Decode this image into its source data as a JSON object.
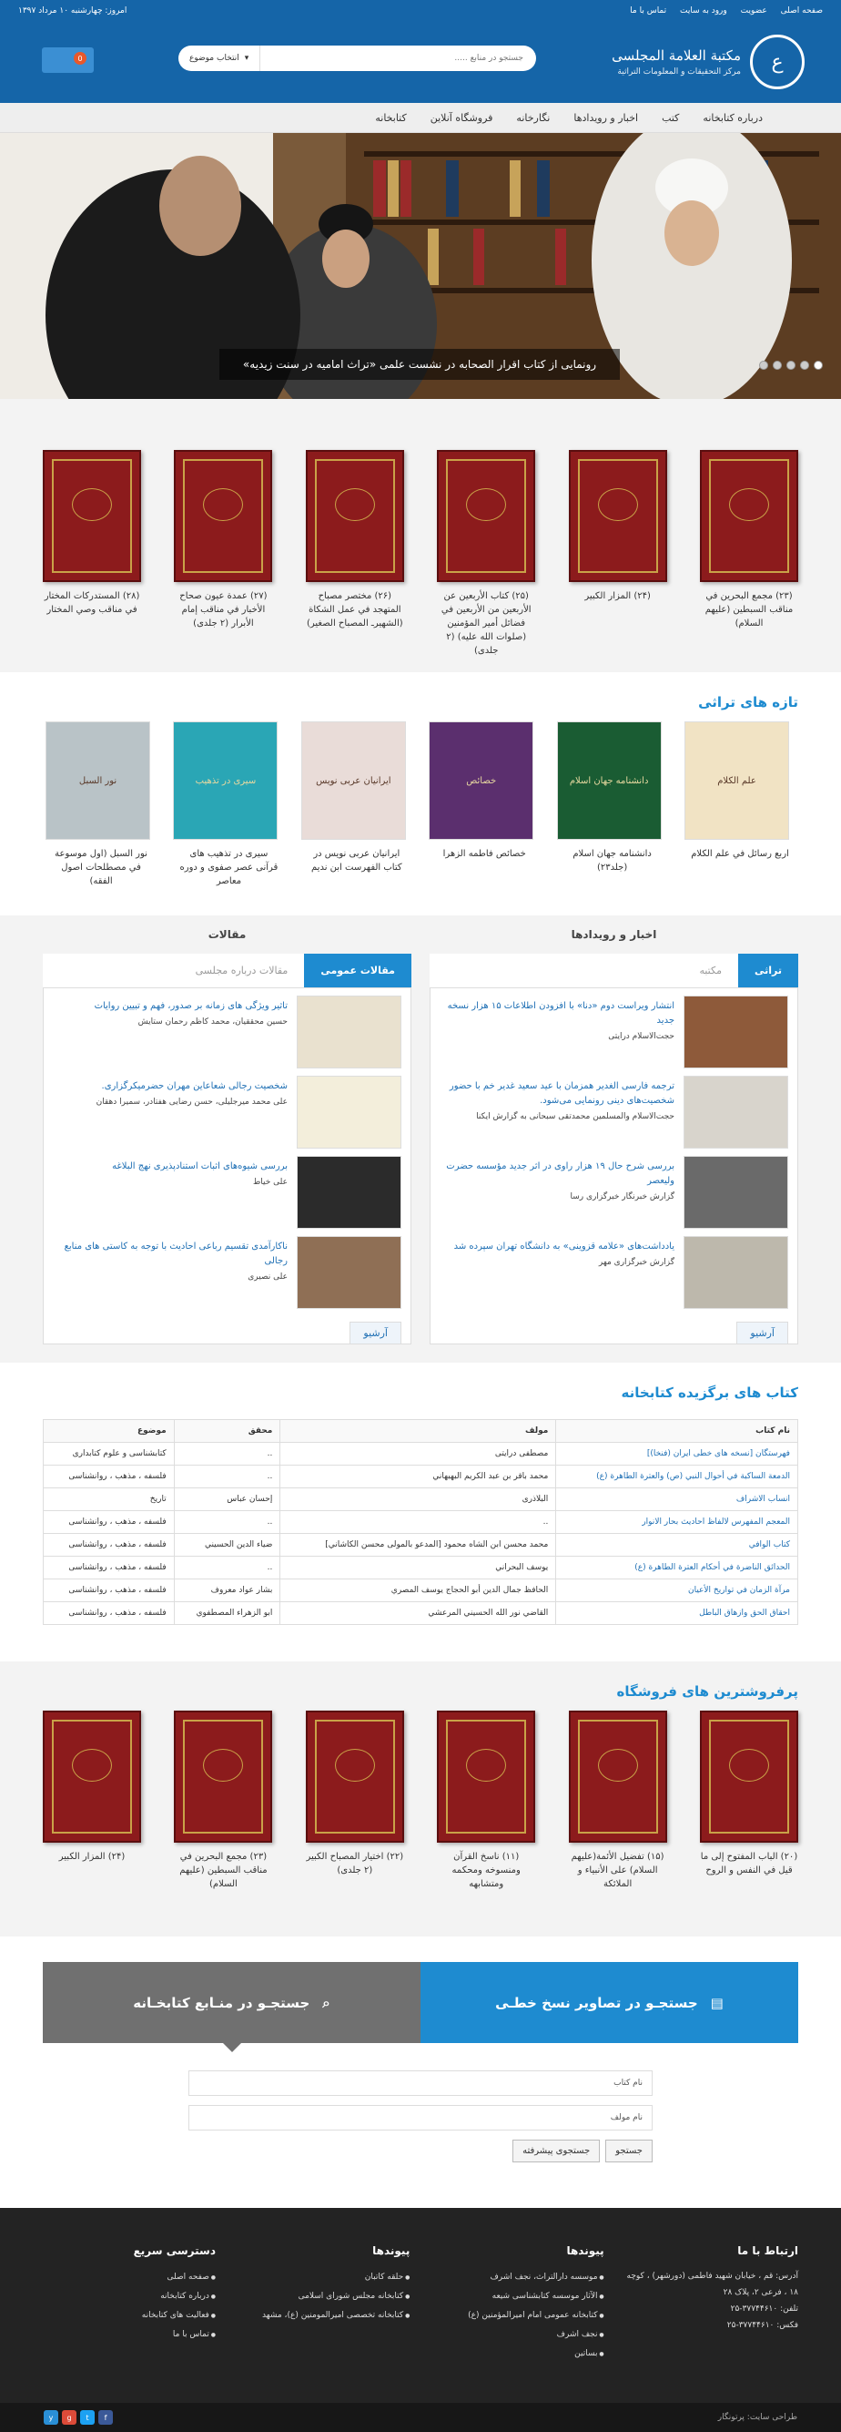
{
  "topbar": {
    "links": [
      "صفحه اصلی",
      "عضویت",
      "ورود به سایت",
      "تماس با ما"
    ],
    "date": "امروز: چهارشنبه ۱۰ مرداد ۱۳۹۷"
  },
  "logo": {
    "seal": "ع",
    "line1": "مکتبة العلامة المجلسی",
    "line2": "مرکز التحقیقات و المعلومات التراثیة"
  },
  "search": {
    "placeholder": "جستجو در منابع .....",
    "select_label": "انتخاب موضوع"
  },
  "cart": {
    "count": "0"
  },
  "nav": [
    "درباره کتابخانه",
    "کتب",
    "اخبار و رویدادها",
    "نگارخانه",
    "فروشگاه آنلاین",
    "کتابخانه"
  ],
  "hero": {
    "caption": "رونمایی از کتاب اقرار الصحابه در نشست علمی «تراث امامیه در سنت زیدیه»",
    "dots": 5
  },
  "popular": {
    "books": [
      "(۲۳) مجمع البحرين في مناقب السبطين (عليهم السلام)",
      "(۲۴) المزار الكبير",
      "(۲۵) كتاب الأربعين عن الأربعين من الأربعين في فضائل أمير المؤمنين (صلوات الله عليه) (۲ جلدی)",
      "(۲۶) مختصر مصباح المتهجد في عمل الشكاة (الشهيرـ المصباح الصغير)",
      "(۲۷) عمدة عيون صحاح الأخبار في مناقب إمام الأبرار (۲ جلدی)",
      "(۲۸) المستدركات المختار في مناقب وصي المختار"
    ]
  },
  "new": {
    "title": "تازه های تراثی",
    "books": [
      {
        "name": "اربع رسائل في علم الكلام",
        "cover": "#f1e3c4",
        "cover_text": "علم الكلام"
      },
      {
        "name": "دانشنامه جهان اسلام (جلد۲۳)",
        "cover": "#1a5c33",
        "cover_text": "دانشنامه جهان اسلام"
      },
      {
        "name": "خصائص فاطمه الزهرا",
        "cover": "#5b2f6e",
        "cover_text": "خصائص"
      },
      {
        "name": "ایرانیان عربی نویس در کتاب الفهرست ابن ندیم",
        "cover": "#e9dcd8",
        "cover_text": "ایرانیان عربی نویس"
      },
      {
        "name": "سیری در تذهیب های قرآنی عصر صفوی و دوره معاصر",
        "cover": "#2aa6b5",
        "cover_text": "سیری در تذهیب"
      },
      {
        "name": "نور السبل (اول موسوعة في مصطلحات اصول الفقه)",
        "cover": "#b9c3c7",
        "cover_text": "نور السبل"
      }
    ]
  },
  "news": {
    "heading": "اخبار و رویدادها",
    "tabs": [
      "تراثی",
      "مکتبه"
    ],
    "items": [
      {
        "title": "انتشار ویراست دوم «دنا» با افزودن اطلاعات ۱۵ هزار نسخه جدید",
        "sub": "حجت‌الاسلام درایتی"
      },
      {
        "title": "ترجمه فارسی الغدیر همزمان با عید سعید غدیر خم با حضور شخصیت‌های دینی رونمایی می‌شود.",
        "sub": "حجت‌الاسلام والمسلمین محمدتقی سبحانی به گزارش ایکنا"
      },
      {
        "title": "بررسی شرح حال ۱۹ هزار راوی در اثر جدید مؤسسه حضرت ولیعصر",
        "sub": "گزارش خبرنگار خبرگزاری رسا"
      },
      {
        "title": "یادداشت‌های «علامه قزوینی» به دانشگاه تهران سپرده شد",
        "sub": "گزارش خبرگزاری مهر"
      }
    ],
    "archive": "آرشیو"
  },
  "articles": {
    "heading": "مقالات",
    "tabs": [
      "مقالات عمومی",
      "مقالات درباره مجلسی"
    ],
    "items": [
      {
        "title": "تاثیر ویژگی های زمانه بر صدور، فهم و تبیین روایات",
        "sub": "حسین محققیان، محمد کاظم رحمان ستایش"
      },
      {
        "title": "شخصیت رجالی شعاعاین مهران حضرمیکرگزاری.",
        "sub": "علی محمد میرجلیلی، حسن رضایی هفتادر، سمیرا دهقان"
      },
      {
        "title": "بررسی شیوه‌های اثبات استنادپذیری نهج البلاغه",
        "sub": "علی خیاط"
      },
      {
        "title": "ناکارآمدی تقسیم رباعی احادیث با توجه به کاستی های منابع رجالی",
        "sub": "علی نصیری"
      }
    ],
    "archive": "آرشیو"
  },
  "featured": {
    "title": "کتاب های برگزیده کتابخانه",
    "headers": [
      "نام کتاب",
      "مولف",
      "محقق",
      "موضوع"
    ],
    "rows": [
      [
        "فهرستگان [نسخه های خطی ایران (فنخا)]",
        "مصطفی درایتی",
        "..",
        "کتابشناسی و علوم کتابداری"
      ],
      [
        "الدمعة الساكبة في أحوال النبي (ص) والعترة الطاهرة (ع)",
        "محمد باقر بن عبد الكريم البهبهاني",
        "..",
        "فلسفه ، مذهب ، روانشناسی"
      ],
      [
        "انساب الاشراف",
        "البلاذری",
        "إحسان عباس",
        "تاریخ"
      ],
      [
        "المعجم المفهرس لالفاظ احادیث بحار الانوار",
        "..",
        "..",
        "فلسفه ، مذهب ، روانشناسی"
      ],
      [
        "كتاب الوافي",
        "محمد محسن ابن الشاه محمود [المدعو بالمولى محسن الكاشاني]",
        "ضياء الدين الحسيني",
        "فلسفه ، مذهب ، روانشناسی"
      ],
      [
        "الحدائق الناضرة في أحكام العترة الطاهرة (ع)",
        "يوسف البحراني",
        "..",
        "فلسفه ، مذهب ، روانشناسی"
      ],
      [
        "مرآة الزمان في تواريخ الأعيان",
        "الحافظ جمال الدين أبو الحجاج يوسف المصري",
        "بشار عواد معروف",
        "فلسفه ، مذهب ، روانشناسی"
      ],
      [
        "احقاق الحق وازهاق الباطل",
        "القاضي نور الله الحسيني المرعشي",
        "ابو الزهراء المصطفوي",
        "فلسفه ، مذهب ، روانشناسی"
      ]
    ]
  },
  "bestsellers": {
    "title": "پرفروشترین های فروشگاه",
    "books": [
      "(۲۰) الباب المفتوح إلى ما قيل في النفس و الروح",
      "(۱۵) تفضيل الأئمة(عليهم السلام) على الأنبياء و الملائكة",
      "(۱۱) ناسخ القرآن ومنسوخه ومحكمه ومتشابهه",
      "(۲۲) اختيار المصباح الكبير (۲ جلدی)",
      "(۲۳) مجمع البحرين في مناقب السبطين (عليهم السلام)",
      "(۲۴) المزار الكبير"
    ]
  },
  "searchboxes": {
    "manuscripts": "جستجـو در تصاویر نسخ خطـی",
    "library": "جستجـو در منـابع کتابخـانه",
    "field1": "نام کتاب",
    "field2": "نام مولف",
    "btn_search": "جستجو",
    "btn_advanced": "جستجوی پیشرفته"
  },
  "footer": {
    "contact": {
      "title": "ارتباط با ما",
      "lines": [
        "آدرس: قم ، خیابان شهید فاطمی (دورشهر) ، کوچه ۱۸ ، فرعی ۲، پلاک ۲۸",
        "تلفن: ۳۷۷۴۴۶۱۰-۲۵",
        "فکس: ۳۷۷۴۴۶۱۰-۲۵"
      ]
    },
    "links1": {
      "title": "پیوندها",
      "items": [
        "موسسه دارالتراث، نجف اشرف",
        "الآثار موسسه کتابشناسی شیعه",
        "کتابخانه عمومی امام امیرالمؤمنین (ع)",
        "نجف اشرف",
        "بساتین"
      ]
    },
    "links2": {
      "title": "پیوندها",
      "items": [
        "حلقه کاتبان",
        "کتابخانه مجلس شورای اسلامی",
        "کتابخانه تخصصی امیرالمومنین (ع)، مشهد"
      ]
    },
    "quick": {
      "title": "دسترسی سریع",
      "items": [
        "صفحه اصلی",
        "درباره کتابخانه",
        "فعالیت های کتابخانه",
        "تماس با ما"
      ]
    },
    "copyright": "طراحی سایت: پرتونگار",
    "social": [
      "f",
      "t",
      "g",
      "y"
    ]
  }
}
